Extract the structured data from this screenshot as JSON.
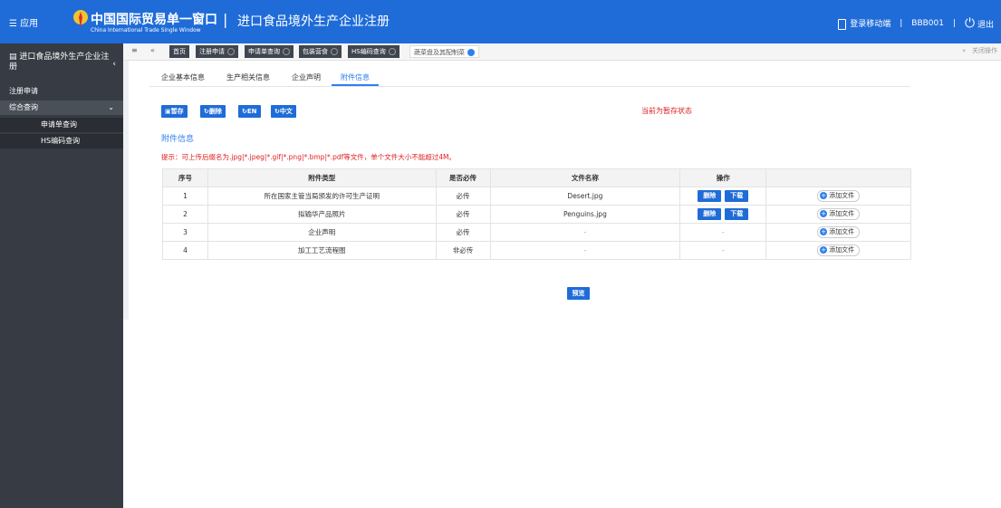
{
  "header": {
    "menu_label": "☰ 应用",
    "logo_cn": "中国国际贸易单一窗口",
    "logo_en": "China International Trade Single Window",
    "separator": "|",
    "title": "进口食品境外生产企业注册",
    "mobile_login": "登录移动端",
    "user": "BBB001",
    "logout": "退出",
    "divider": "|"
  },
  "sidebar": {
    "title": "进口食品境外生产企业注册",
    "items": [
      {
        "label": "注册申请"
      },
      {
        "label": "综合查询"
      },
      {
        "label": "申请单查询"
      },
      {
        "label": "HS编码查询"
      }
    ]
  },
  "tabbar": {
    "tabs": [
      {
        "label": "首页"
      },
      {
        "label": "注册申请"
      },
      {
        "label": "申请单查询"
      },
      {
        "label": "包装营食"
      },
      {
        "label": "HS编码查询"
      },
      {
        "label": "蔬菜盘及其配制菜"
      }
    ],
    "close_ops": "关闭操作"
  },
  "subtabs": [
    "企业基本信息",
    "生产相关信息",
    "企业声明",
    "附件信息"
  ],
  "toolbar": {
    "save": "暂存",
    "delete": "删除",
    "en": "EN",
    "zh": "中文"
  },
  "status_text": "当前为暂存状态",
  "section_title": "附件信息",
  "hint": "提示：可上传后缀名为.jpg|*.jpeg|*.gif|*.png|*.bmp|*.pdf等文件，单个文件大小不能超过4M。",
  "table": {
    "headers": [
      "序号",
      "附件类型",
      "是否必传",
      "文件名称",
      "操作",
      ""
    ],
    "rows": [
      {
        "no": "1",
        "type": "所在国家主管当局颁发的许可生产证明",
        "required": "必传",
        "filename": "Desert.jpg",
        "has_file": true
      },
      {
        "no": "2",
        "type": "拟输华产品照片",
        "required": "必传",
        "filename": "Penguins.jpg",
        "has_file": true
      },
      {
        "no": "3",
        "type": "企业声明",
        "required": "必传",
        "filename": "-",
        "op": "-",
        "has_file": false
      },
      {
        "no": "4",
        "type": "加工工艺流程图",
        "required": "非必传",
        "filename": "-",
        "op": "-",
        "has_file": false
      }
    ],
    "delete_label": "删除",
    "download_label": "下载",
    "add_file_label": "添加文件"
  },
  "preview_label": "预览",
  "colors": {
    "primary": "#1f6cd8",
    "sidebar": "#373c44",
    "alert": "#e02020"
  }
}
